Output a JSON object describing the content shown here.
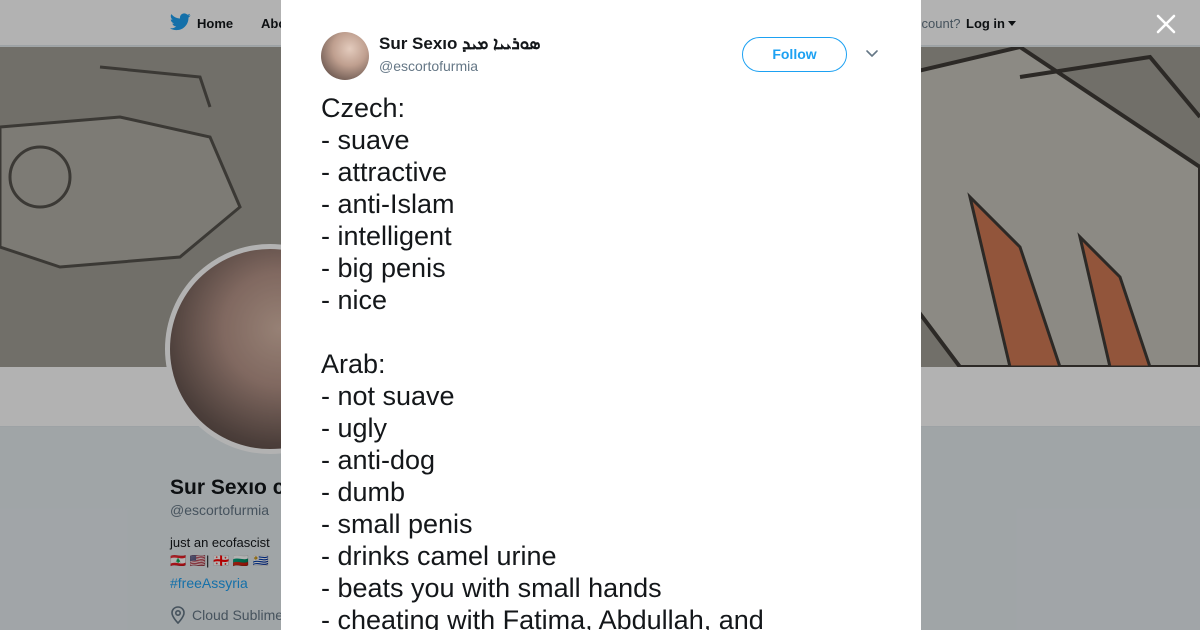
{
  "nav": {
    "home_label": "Home",
    "about_label": "Abo",
    "account_prompt": "ccount?",
    "login_label": "Log in"
  },
  "profile": {
    "name": "Sur Sexıo",
    "name_visible": "Sur Sexıo c",
    "handle": "@escortofurmia",
    "bio": "just an ecofascist",
    "flags": "🇱🇧 🇺🇸| 🇬🇪 🇧🇬 🇺🇾",
    "hashtag": "#freeAssyria",
    "location": "Cloud Sublime"
  },
  "tweet": {
    "author_name": "Sur Sexıo ܣܘܪܝܝܐ ܡܝܕ",
    "author_handle": "@escortofurmia",
    "follow_label": "Follow",
    "lines": [
      "Czech:",
      "- suave",
      "- attractive",
      "- anti-Islam",
      "- intelligent",
      "- big penis",
      "- nice",
      "",
      "Arab:",
      "- not suave",
      "- ugly",
      "- anti-dog",
      "- dumb",
      "- small penis",
      "- drinks camel urine",
      "- beats you with small hands",
      "- cheating with Fatima, Abdullah, and"
    ]
  },
  "colors": {
    "accent": "#1da1f2",
    "text": "#14171a",
    "muted": "#657786",
    "page_bg": "#e6ecf0",
    "overlay": "rgba(0,0,0,0.3)"
  },
  "icons": {
    "logo": "twitter-bird-icon",
    "close": "close-icon",
    "more": "chevron-down-icon",
    "location": "location-pin-icon"
  }
}
